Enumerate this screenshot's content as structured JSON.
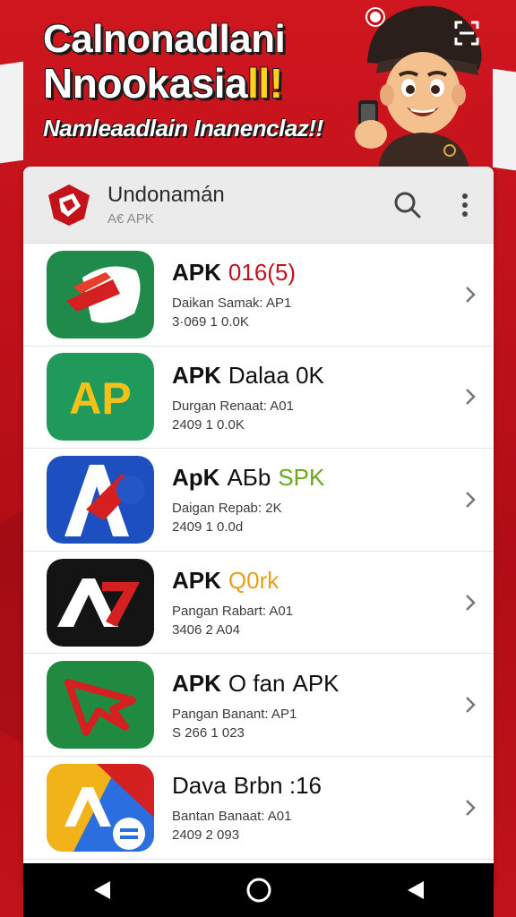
{
  "banner": {
    "line1": "Calnonadlani",
    "line2": "Nnookasia",
    "line2_accent": "ll!",
    "line3": "Namleaadlain Inanenclaz!!"
  },
  "app": {
    "title": "Undonamán",
    "subtitle": "A€ APK",
    "search_icon": "search-icon",
    "menu_icon": "more-vert-icon"
  },
  "apps": [
    {
      "title": "APK",
      "suffix": "",
      "tag": "016(5)",
      "tag_color": "#c4121a",
      "meta": "Daikan Samak: AP1",
      "size": "3·069 1 0.0K"
    },
    {
      "title": "APK",
      "suffix": "Dalaa 0K",
      "tag": "",
      "tag_color": "#111111",
      "meta": "Durgan Renaat: A01",
      "size": "2409 1 0.0K"
    },
    {
      "title": "ApK",
      "suffix": "AБb",
      "tag": "SPK",
      "tag_color": "#6aa81e",
      "meta": "Daigan Repab: 2K",
      "size": "2409 1 0.0d"
    },
    {
      "title": "APK",
      "suffix": "",
      "tag": "Q0rk",
      "tag_color": "#e6a019",
      "meta": "Pangan Rabart: A01",
      "size": "3406 2 A04"
    },
    {
      "title": "APK",
      "suffix": "O fan",
      "tag": "APK",
      "tag_color": "#111111",
      "meta": "Pangan Banant: AP1",
      "size": "S 266 1 023"
    },
    {
      "title": "Dava",
      "suffix": "Brbn :16",
      "tag": "",
      "tag_color": "#111111",
      "meta": "Bantan Banaat: A01",
      "size": "2409 2 093"
    }
  ],
  "nav": {
    "back": "back-icon",
    "home": "home-icon",
    "recents": "recents-icon"
  }
}
